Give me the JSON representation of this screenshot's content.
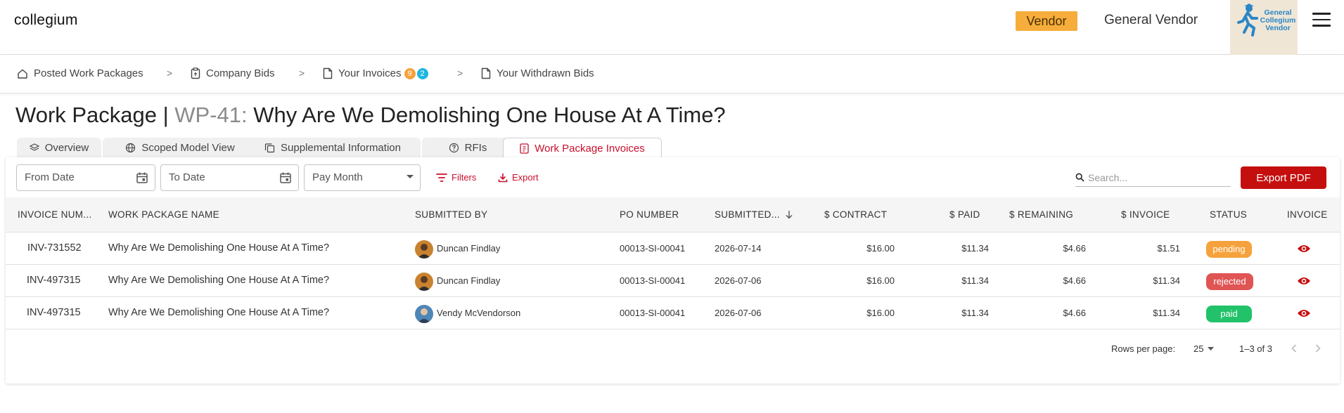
{
  "app": {
    "brand": "collegium"
  },
  "header": {
    "role_badge": "Vendor",
    "user_name": "General Vendor",
    "logo_text": "General Collegium Vendor",
    "menu_icon": "hamburger-icon"
  },
  "breadcrumbs": [
    {
      "label": "Posted Work Packages",
      "icon": "home-icon"
    },
    {
      "label": "Company Bids",
      "icon": "clipboard-icon"
    },
    {
      "label": "Your Invoices",
      "icon": "document-icon",
      "counts": [
        {
          "value": "9",
          "color": "#f6a23c"
        },
        {
          "value": "2",
          "color": "#1fb6e0"
        }
      ]
    },
    {
      "label": "Your Withdrawn Bids",
      "icon": "document-icon"
    }
  ],
  "separator": ">",
  "page": {
    "title_prefix": "Work Package | ",
    "wp_code": "WP-41:",
    "title_name": " Why Are We Demolishing One House At A Time?"
  },
  "tabs": [
    {
      "label": "Overview",
      "icon": "layers-icon",
      "active": false
    },
    {
      "label": "Scoped Model View",
      "icon": "globe-icon",
      "active": false
    },
    {
      "label": "Supplemental Information",
      "icon": "copy-icon",
      "active": false
    },
    {
      "label": "RFIs",
      "icon": "question-circle-icon",
      "active": false
    },
    {
      "label": "Work Package Invoices",
      "icon": "invoice-icon",
      "active": true
    }
  ],
  "filters": {
    "from_date": "From Date",
    "to_date": "To Date",
    "pay_month": "Pay Month",
    "filters_label": "Filters",
    "export_label": "Export",
    "search_placeholder": "Search...",
    "export_pdf": "Export PDF"
  },
  "table": {
    "columns": [
      "INVOICE NUM...",
      "WORK PACKAGE NAME",
      "SUBMITTED BY",
      "PO NUMBER",
      "SUBMITTED...",
      "$ CONTRACT",
      "$ PAID",
      "$ REMAINING",
      "$ INVOICE",
      "STATUS",
      "INVOICE"
    ],
    "rows": [
      {
        "invoice": "INV-731552",
        "wp_name": "Why Are We Demolishing One House At A Time?",
        "submitted_by": "Duncan Findlay",
        "po": "00013-SI-00041",
        "submitted": "2026-07-14",
        "contract": "$16.00",
        "paid": "$11.34",
        "remaining": "$4.66",
        "invoice_amt": "$1.51",
        "status": "pending"
      },
      {
        "invoice": "INV-497315",
        "wp_name": "Why Are We Demolishing One House At A Time?",
        "submitted_by": "Duncan Findlay",
        "po": "00013-SI-00041",
        "submitted": "2026-07-06",
        "contract": "$16.00",
        "paid": "$11.34",
        "remaining": "$4.66",
        "invoice_amt": "$11.34",
        "status": "rejected"
      },
      {
        "invoice": "INV-497315",
        "wp_name": "Why Are We Demolishing One House At A Time?",
        "submitted_by": "Vendy McVendorson",
        "po": "00013-SI-00041",
        "submitted": "2026-07-06",
        "contract": "$16.00",
        "paid": "$11.34",
        "remaining": "$4.66",
        "invoice_amt": "$11.34",
        "status": "paid"
      }
    ]
  },
  "status_colors": {
    "pending": "#f6a23c",
    "rejected": "#e05454",
    "paid": "#22c26a"
  },
  "pagination": {
    "rows_per_page_label": "Rows per page:",
    "rows_per_page": "25",
    "range": "1–3 of 3"
  },
  "colors": {
    "accent": "#c8102e",
    "vendor_badge": "#f6ad3c",
    "export_pdf": "#c50f0f"
  }
}
